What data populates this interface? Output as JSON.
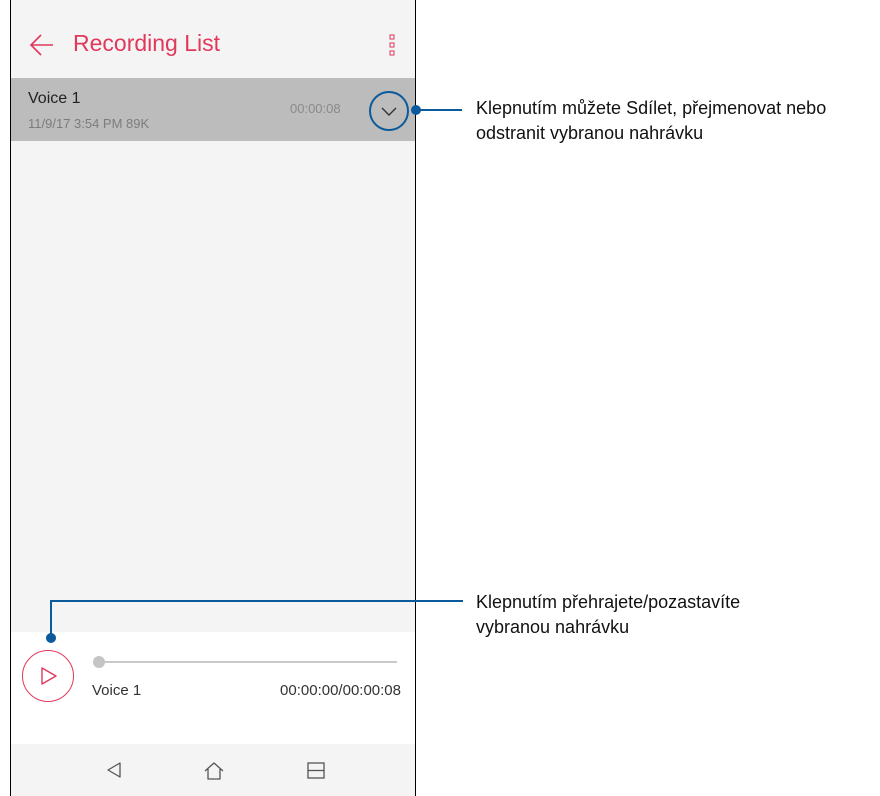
{
  "app_bar": {
    "title": "Recording List",
    "back_icon": "arrow-left-icon",
    "menu_icon": "more-vertical-icon"
  },
  "recording": {
    "name": "Voice 1",
    "meta": "11/9/17 3:54 PM  89K",
    "duration": "00:00:08",
    "expand_icon": "chevron-down-icon"
  },
  "player": {
    "play_icon": "play-icon",
    "track_name": "Voice 1",
    "time": "00:00:00/00:00:08",
    "progress": 0
  },
  "nav_bar": {
    "back_icon": "nav-back-icon",
    "home_icon": "nav-home-icon",
    "recents_icon": "nav-recents-icon"
  },
  "annotations": {
    "expand": {
      "line1": "Klepnutím můžete Sdílet, přejmenovat nebo",
      "line2": "odstranit vybranou nahrávku"
    },
    "play": {
      "line1": "Klepnutím přehrajete/pozastavíte",
      "line2": "vybranou nahrávku"
    }
  },
  "colors": {
    "accent": "#e0395c",
    "callout": "#0b5a9c",
    "selected_row": "#bcbcbc",
    "background": "#f4f4f4"
  }
}
